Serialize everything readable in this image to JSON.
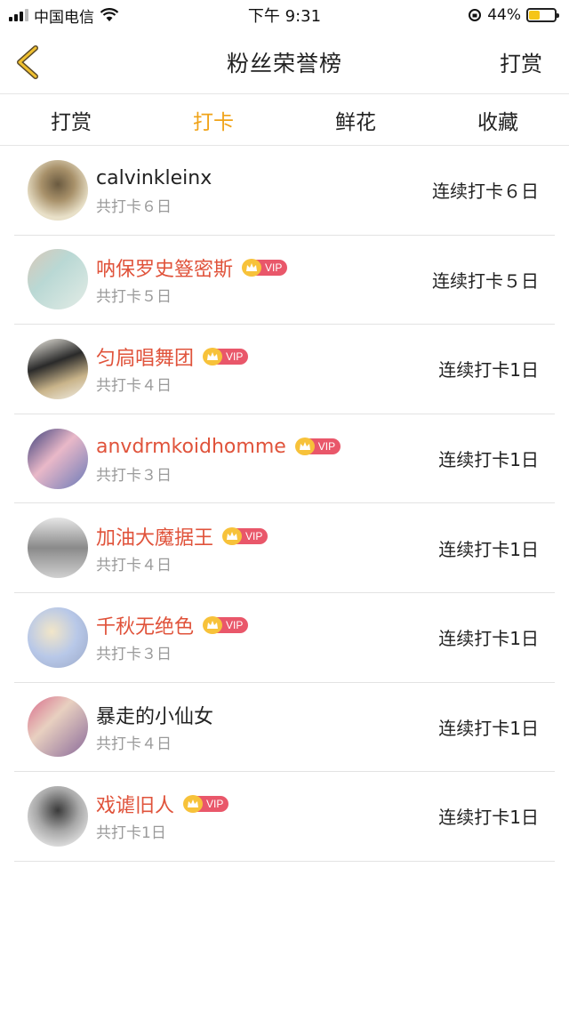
{
  "status_bar": {
    "carrier": "中国电信",
    "time": "下午 9:31",
    "battery": "44%",
    "battery_level": 0.44,
    "signal_icon": "signal-icon",
    "wifi_icon": "wifi-icon"
  },
  "nav": {
    "back_icon": "chevron-left-icon",
    "title": "粉丝荣誉榜",
    "right_label": "打赏"
  },
  "tabs": [
    {
      "label": "打赏",
      "active": false
    },
    {
      "label": "打卡",
      "active": true
    },
    {
      "label": "鲜花",
      "active": false
    },
    {
      "label": "收藏",
      "active": false
    }
  ],
  "vip_label": "VIP",
  "colors": {
    "accent": "#f0a318",
    "vip_name": "#e0533b",
    "vip_badge": "#e9576a",
    "crown": "#f7c23a"
  },
  "fans": [
    {
      "name": "calvinkleinx",
      "vip": false,
      "total": "共打卡６日",
      "streak": "连续打卡６日"
    },
    {
      "name": "呐保罗史簦密斯",
      "vip": true,
      "total": "共打卡５日",
      "streak": "连续打卡５日"
    },
    {
      "name": "匀扃唱舞团",
      "vip": true,
      "total": "共打卡４日",
      "streak": "连续打卡1日"
    },
    {
      "name": "anvdrmkoidhomme",
      "vip": true,
      "total": "共打卡３日",
      "streak": "连续打卡1日"
    },
    {
      "name": "加油大魔据王",
      "vip": true,
      "total": "共打卡４日",
      "streak": "连续打卡1日"
    },
    {
      "name": "千秋无绝色",
      "vip": true,
      "total": "共打卡３日",
      "streak": "连续打卡1日"
    },
    {
      "name": "暴走的小仙女",
      "vip": false,
      "total": "共打卡４日",
      "streak": "连续打卡1日"
    },
    {
      "name": "戏谑旧人",
      "vip": true,
      "total": "共打卡1日",
      "streak": "连续打卡1日"
    }
  ]
}
